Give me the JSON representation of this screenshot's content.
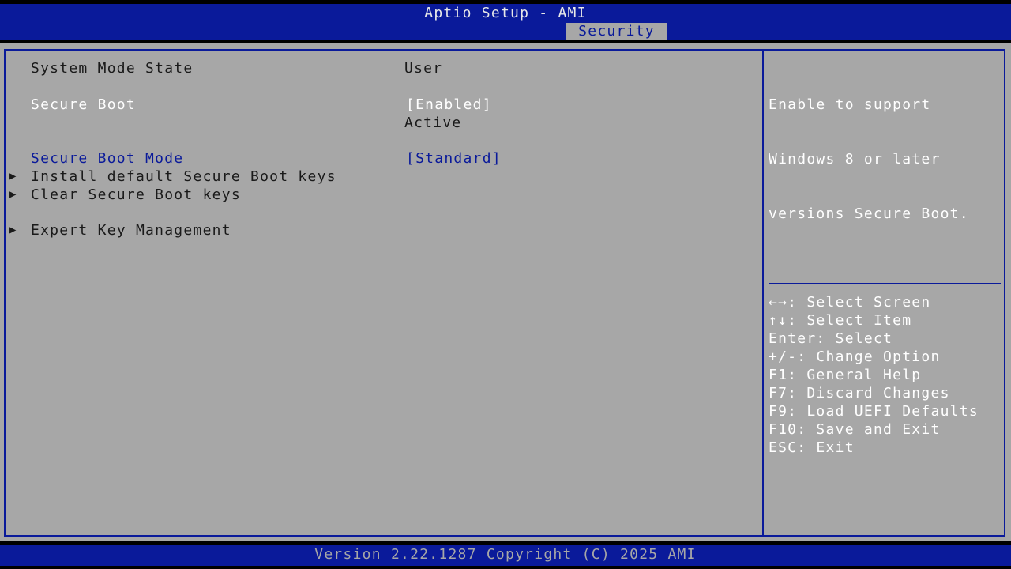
{
  "header": {
    "title": "Aptio Setup - AMI",
    "active_tab": "Security"
  },
  "settings": {
    "system_mode_state": {
      "label": "System Mode State",
      "value": "User"
    },
    "secure_boot": {
      "label": "Secure Boot",
      "value": "[Enabled]",
      "status": "Active"
    },
    "secure_boot_mode": {
      "label": "Secure Boot Mode",
      "value": "[Standard]"
    },
    "submenus": [
      {
        "label": "Install default Secure Boot keys",
        "icon": "triangle-right-icon"
      },
      {
        "label": "Clear Secure Boot keys",
        "icon": "triangle-right-icon"
      },
      {
        "label": "Expert Key Management",
        "icon": "triangle-right-icon"
      }
    ]
  },
  "help": {
    "lines": [
      "Enable to support",
      "Windows 8 or later",
      "versions Secure Boot."
    ]
  },
  "keys": [
    "←→: Select Screen",
    "↑↓: Select Item",
    "Enter: Select",
    "+/-: Change Option",
    "F1: General Help",
    "F7: Discard Changes",
    "F9: Load UEFI Defaults",
    "F10: Save and Exit",
    "ESC: Exit"
  ],
  "footer": {
    "text": "Version 2.22.1287 Copyright (C) 2025 AMI"
  },
  "colors": {
    "band_blue": "#0a1a9a",
    "panel_gray": "#a7a7a7",
    "selected_white": "#ffffff",
    "configurable_blue": "#0a1a9a",
    "readonly_text": "#1a1a1a"
  }
}
